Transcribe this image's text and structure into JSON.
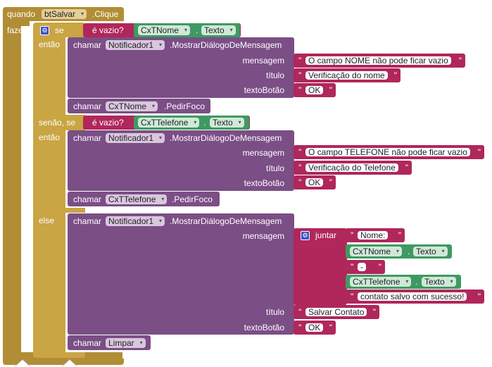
{
  "event": {
    "when": "quando",
    "component": "btSalvar",
    "event_name": ".Clique",
    "do": "fazer"
  },
  "if_block": {
    "if_label": "se",
    "then_label": "então",
    "else_if_label": "senão, se",
    "else_label": "else"
  },
  "is_empty": "é vazio?",
  "call": "chamar",
  "dot": ".",
  "textbox1": {
    "component": "CxTNome",
    "property": "Texto"
  },
  "textbox2": {
    "component": "CxTTelefone",
    "property": "Texto"
  },
  "notifier": {
    "component": "Notificador1",
    "method": ".MostrarDiálogoDeMensagem"
  },
  "params": {
    "message": "mensagem",
    "title": "título",
    "button_text": "textoBotão"
  },
  "dialog1": {
    "message": "O campo NOME não pode ficar vazio",
    "title": "Verificação do nome",
    "button": "OK"
  },
  "focus1": {
    "component": "CxTNome",
    "method": ".PedirFoco"
  },
  "dialog2": {
    "message": "O campo TELEFONE não pode ficar vazio",
    "title": "Verificação do Telefone",
    "button": "OK"
  },
  "focus2": {
    "component": "CxTTelefone",
    "method": ".PedirFoco"
  },
  "join": {
    "label": "juntar",
    "part1": "Nome:",
    "part3": "-",
    "part5": "contato salvo com sucesso!"
  },
  "dialog3": {
    "title": "Salvar Contato",
    "button": "OK"
  },
  "clear_proc": {
    "name": "Limpar"
  },
  "quote": "\"",
  "arrow": "▾",
  "gear": "⚙",
  "colors": {
    "event": "#b18e35",
    "control": "#c9a544",
    "component": "#7b4e86",
    "getter": "#3e9a62",
    "text": "#b0275b",
    "logic": "#3d52c9"
  }
}
